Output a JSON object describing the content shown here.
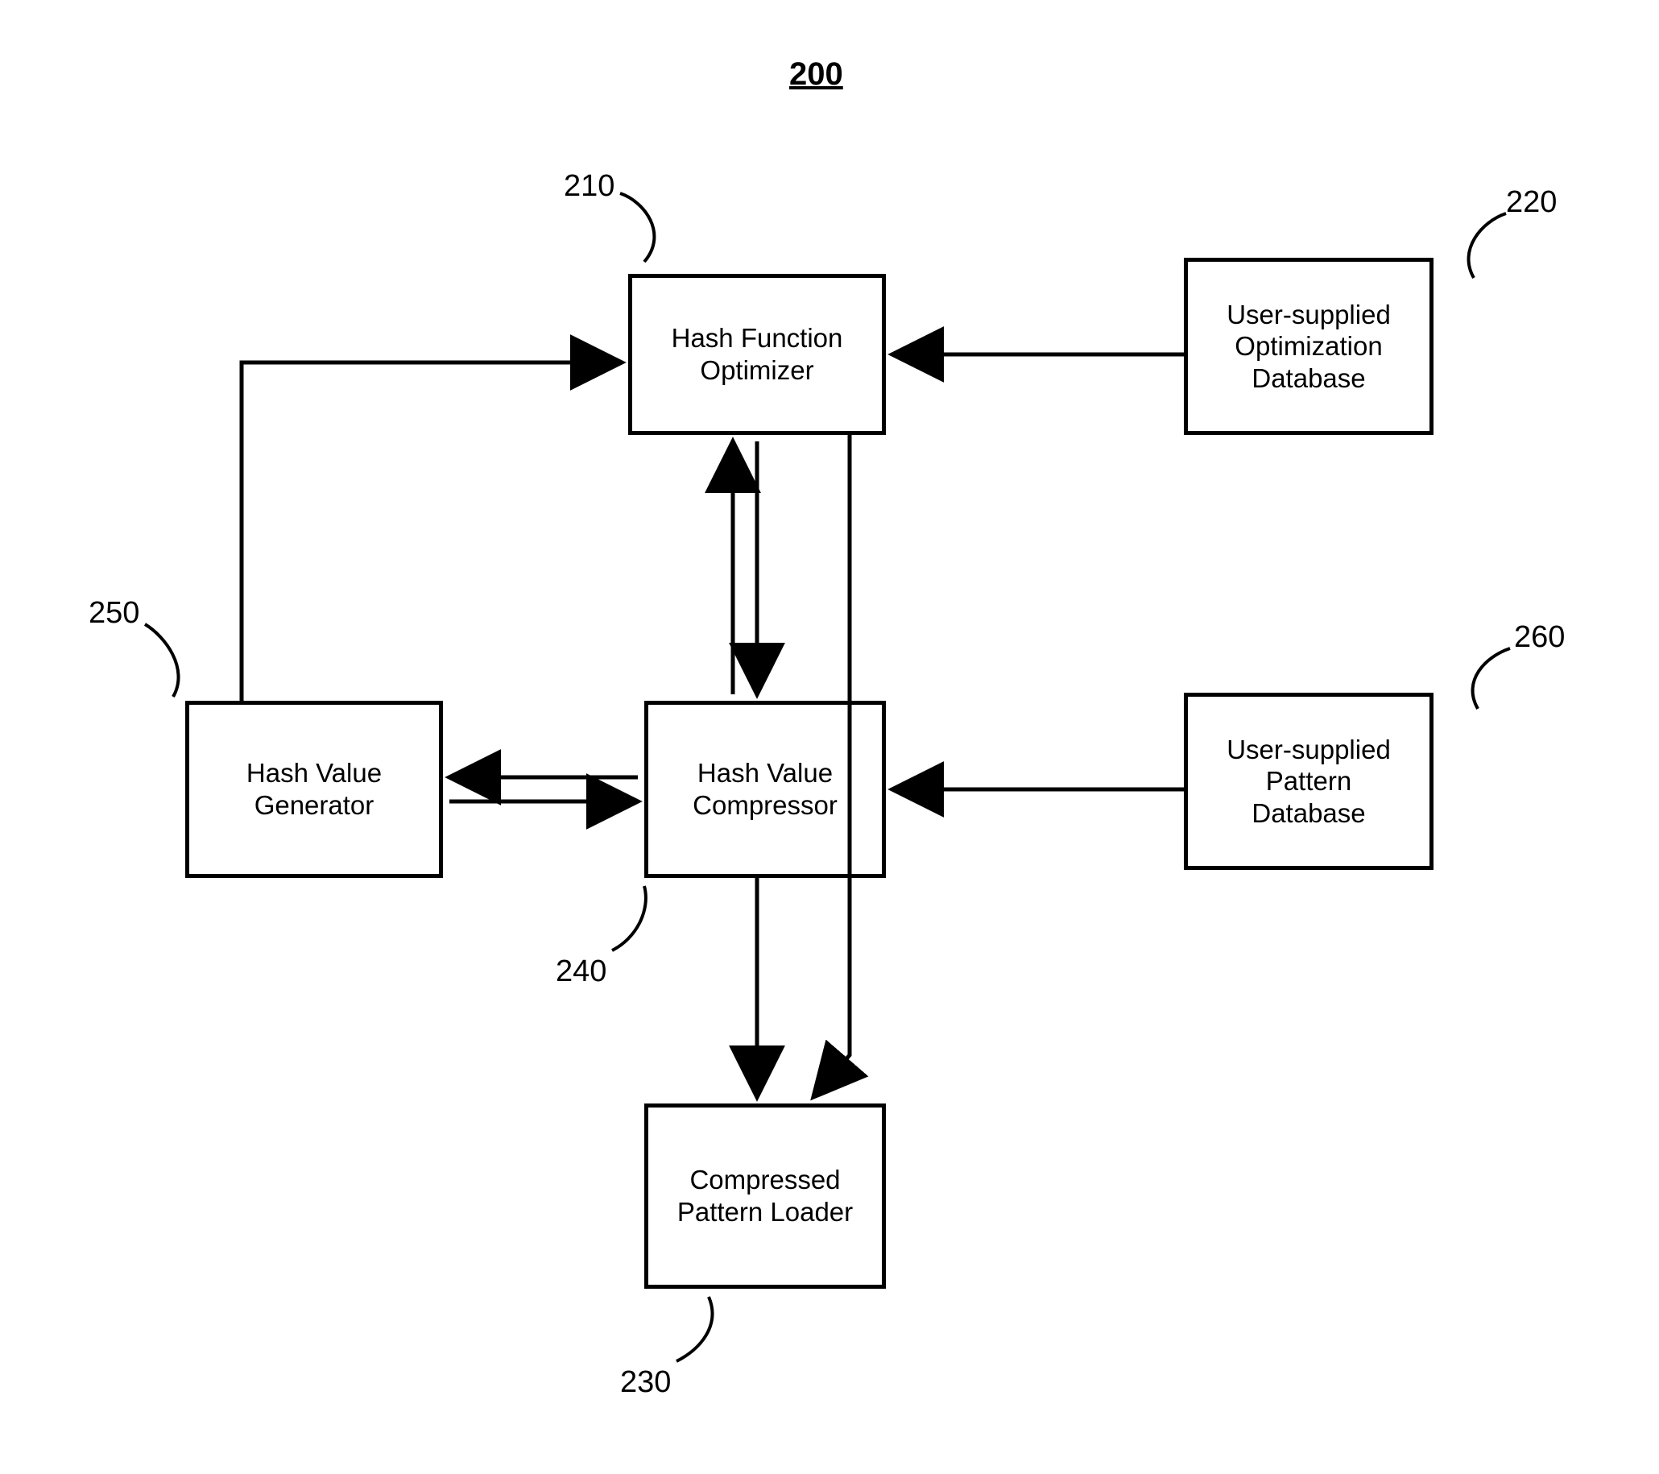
{
  "figure": {
    "number": "200"
  },
  "boxes": {
    "hash_function_optimizer": {
      "label": "Hash Function\nOptimizer",
      "ref": "210"
    },
    "user_opt_db": {
      "label": "User-supplied\nOptimization\nDatabase",
      "ref": "220"
    },
    "hash_value_generator": {
      "label": "Hash Value\nGenerator",
      "ref": "250"
    },
    "hash_value_compressor": {
      "label": "Hash Value\nCompressor",
      "ref": "240"
    },
    "user_pattern_db": {
      "label": "User-supplied\nPattern\nDatabase",
      "ref": "260"
    },
    "compressed_pattern_loader": {
      "label": "Compressed\nPattern Loader",
      "ref": "230"
    }
  }
}
